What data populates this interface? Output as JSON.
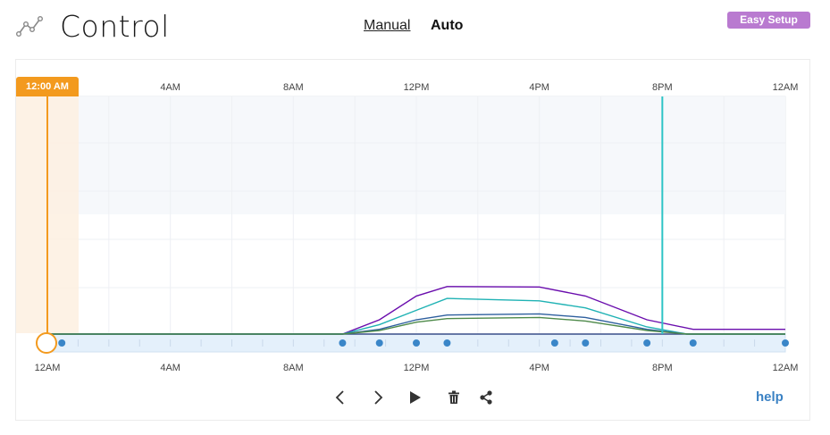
{
  "header": {
    "title": "Control",
    "icon": "chart-line-icon"
  },
  "modes": {
    "manual": "Manual",
    "auto": "Auto",
    "active": "Auto"
  },
  "easy_setup": "Easy Setup",
  "current_time": "12:00 AM",
  "help": "help",
  "colors": {
    "accent": "#f39a1e",
    "now_line": "#2ec4c6",
    "easy": "#b97ad0",
    "point": "#3a86c8"
  },
  "controls": [
    {
      "name": "prev-button",
      "icon": "chevron-left-icon"
    },
    {
      "name": "next-button",
      "icon": "chevron-right-icon"
    },
    {
      "name": "play-button",
      "icon": "play-icon"
    },
    {
      "name": "delete-button",
      "icon": "trash-icon"
    },
    {
      "name": "share-button",
      "icon": "share-icon"
    }
  ],
  "chart_data": {
    "type": "line",
    "x_ticks_top": [
      "4AM",
      "8AM",
      "12PM",
      "4PM",
      "8PM",
      "12AM"
    ],
    "x_ticks_bottom": [
      "12AM",
      "4AM",
      "8AM",
      "12PM",
      "4PM",
      "8PM",
      "12AM"
    ],
    "xlim": [
      0,
      24
    ],
    "ylim": [
      0,
      100
    ],
    "now_hour": 20,
    "series": [
      {
        "color": "#6a0dad",
        "points": [
          [
            9.6,
            0
          ],
          [
            10.8,
            6
          ],
          [
            12,
            16
          ],
          [
            13,
            20
          ],
          [
            16,
            19.8
          ],
          [
            17.5,
            16
          ],
          [
            19.5,
            6
          ],
          [
            21,
            2
          ],
          [
            24,
            2
          ]
        ]
      },
      {
        "color": "#1fb2b4",
        "points": [
          [
            9.6,
            0
          ],
          [
            10.8,
            4
          ],
          [
            12,
            10
          ],
          [
            13,
            15
          ],
          [
            16,
            14
          ],
          [
            17.5,
            11
          ],
          [
            19.5,
            3
          ],
          [
            20.8,
            0
          ],
          [
            24,
            0
          ]
        ]
      },
      {
        "color": "#2e5f9e",
        "points": [
          [
            9.6,
            0
          ],
          [
            10.8,
            2
          ],
          [
            12,
            6
          ],
          [
            13,
            8
          ],
          [
            16,
            8.5
          ],
          [
            17.5,
            7
          ],
          [
            19.5,
            2
          ],
          [
            20.8,
            0
          ],
          [
            24,
            0
          ]
        ]
      },
      {
        "color": "#4e8a4a",
        "points": [
          [
            9.6,
            0
          ],
          [
            10.8,
            1.5
          ],
          [
            12,
            5
          ],
          [
            13,
            6.5
          ],
          [
            16,
            7
          ],
          [
            17.5,
            5.5
          ],
          [
            19.5,
            1.5
          ],
          [
            20.8,
            0
          ],
          [
            24,
            0
          ]
        ]
      }
    ],
    "schedule_points_hours": [
      0.5,
      9.6,
      10.8,
      12,
      13,
      16.5,
      17.5,
      19.5,
      21,
      24
    ]
  }
}
